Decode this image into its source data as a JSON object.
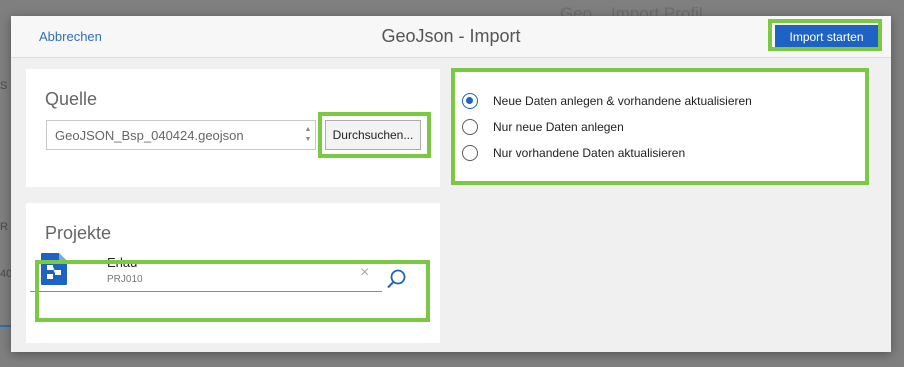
{
  "background": {
    "title": "Geo...  Import Profil",
    "fragments": [
      "S",
      "R",
      "40"
    ]
  },
  "dialog": {
    "cancel_label": "Abbrechen",
    "title": "GeoJson - Import",
    "import_label": "Import starten"
  },
  "source": {
    "title": "Quelle",
    "file_value": "GeoJSON_Bsp_040424.geojson",
    "browse_label": "Durchsuchen..."
  },
  "options": {
    "items": [
      {
        "label": "Neue Daten anlegen & vorhandene aktualisieren",
        "checked": true
      },
      {
        "label": "Nur neue Daten anlegen",
        "checked": false
      },
      {
        "label": "Nur vorhandene Daten aktualisieren",
        "checked": false
      }
    ]
  },
  "projects": {
    "title": "Projekte",
    "name": "Erlau",
    "code": "PRJ010",
    "clear_glyph": "×"
  },
  "colors": {
    "accent": "#1e63c4",
    "highlight": "#7ac943",
    "link": "#2f6fba"
  },
  "icons": {
    "project": "project-icon",
    "search": "search-icon",
    "clear": "close-icon"
  }
}
